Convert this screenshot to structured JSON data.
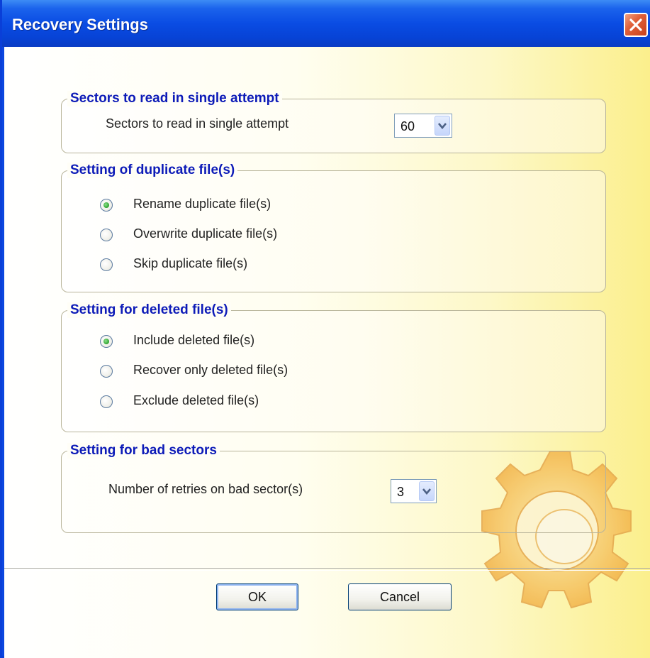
{
  "window": {
    "title": "Recovery Settings"
  },
  "sectors_group": {
    "legend": "Sectors to read in single attempt",
    "label": "Sectors to read in single attempt",
    "value": "60"
  },
  "duplicate_group": {
    "legend": "Setting of duplicate file(s)",
    "options": [
      {
        "label": "Rename duplicate file(s)",
        "selected": true
      },
      {
        "label": "Overwrite duplicate file(s)",
        "selected": false
      },
      {
        "label": "Skip duplicate file(s)",
        "selected": false
      }
    ]
  },
  "deleted_group": {
    "legend": "Setting for deleted file(s)",
    "options": [
      {
        "label": "Include deleted file(s)",
        "selected": true
      },
      {
        "label": "Recover only deleted file(s)",
        "selected": false
      },
      {
        "label": "Exclude deleted file(s)",
        "selected": false
      }
    ]
  },
  "bad_sectors_group": {
    "legend": "Setting for bad sectors",
    "label": "Number of retries on bad sector(s)",
    "value": "3"
  },
  "buttons": {
    "ok": "OK",
    "cancel": "Cancel"
  },
  "icons": {
    "close": "close-icon",
    "dropdown": "chevron-down-icon",
    "gear": "gear-icon"
  },
  "colors": {
    "titlebar": "#0a4ce3",
    "legend_text": "#0d1bb8",
    "close_button": "#e0603a"
  }
}
